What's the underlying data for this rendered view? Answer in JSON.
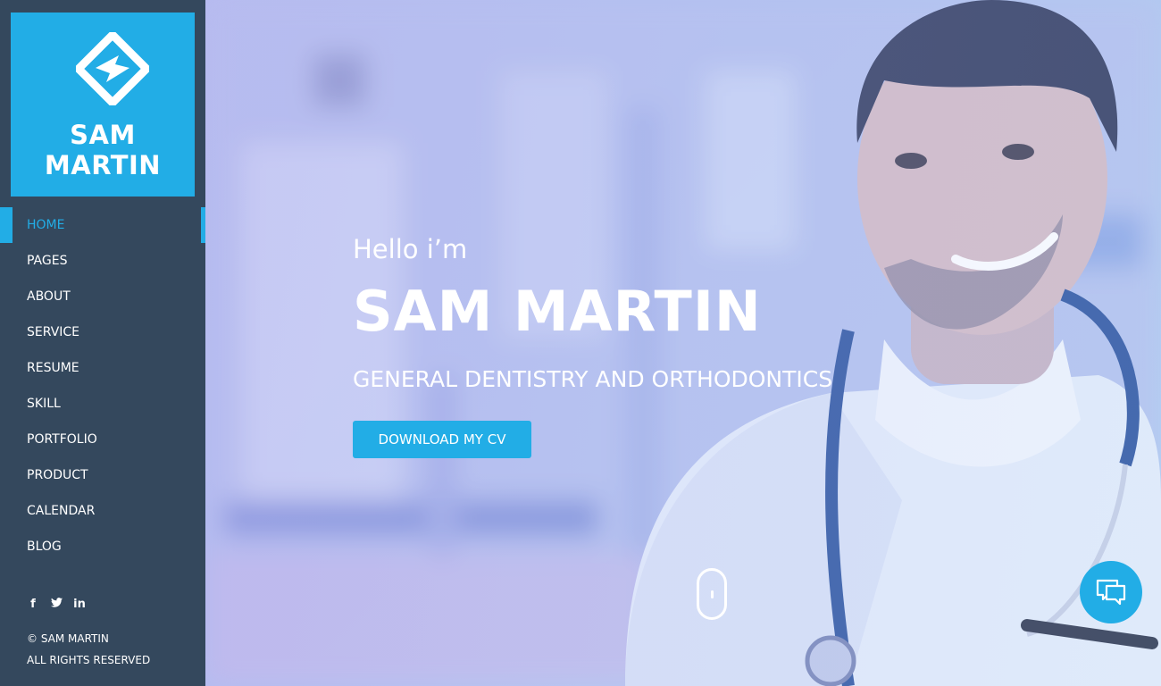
{
  "brand": {
    "line1": "SAM",
    "line2": "MARTIN"
  },
  "nav": {
    "items": [
      {
        "label": "HOME",
        "active": true
      },
      {
        "label": "PAGES"
      },
      {
        "label": "ABOUT"
      },
      {
        "label": "SERVICE"
      },
      {
        "label": "RESUME"
      },
      {
        "label": "SKILL"
      },
      {
        "label": "PORTFOLIO"
      },
      {
        "label": "PRODUCT"
      },
      {
        "label": "CALENDAR"
      },
      {
        "label": "BLOG"
      }
    ]
  },
  "social": {
    "facebook": "f",
    "twitter": "🐦",
    "linkedin": "in"
  },
  "footer": {
    "copyright": "© SAM MARTIN",
    "rights": "ALL RIGHTS RESERVED"
  },
  "hero": {
    "greeting": "Hello i’m",
    "name": "SAM MARTIN",
    "subtitle": "GENERAL DENTISTRY AND ORTHODONTICS",
    "cta_label": "DOWNLOAD MY CV"
  },
  "icons": {
    "logo": "diamond-logo-icon",
    "scroll": "mouse-scroll-icon",
    "chat": "chat-bubbles-icon"
  },
  "colors": {
    "accent": "#22ade6",
    "sidebar": "#34485d"
  }
}
